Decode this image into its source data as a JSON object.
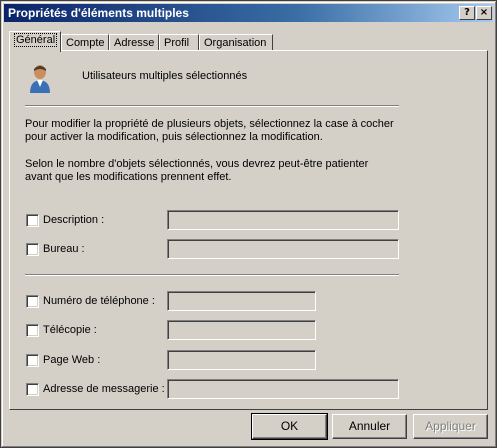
{
  "window": {
    "title": "Propriétés d'éléments multiples"
  },
  "titlebar_buttons": {
    "help": "?",
    "close": "×"
  },
  "tabs": [
    {
      "label": "Général",
      "active": true
    },
    {
      "label": "Compte",
      "active": false
    },
    {
      "label": "Adresse",
      "active": false
    },
    {
      "label": "Profil",
      "active": false
    },
    {
      "label": "Organisation",
      "active": false
    }
  ],
  "header": {
    "text": "Utilisateurs multiples sélectionnés",
    "icon": "users-icon"
  },
  "info": {
    "line1": "Pour modifier la propriété de plusieurs objets, sélectionnez la case à cocher",
    "line2": "pour activer la modification, puis sélectionnez la modification.",
    "line3": "Selon le nombre d'objets sélectionnés, vous devrez peut-être patienter",
    "line4": "avant que les modifications prennent effet."
  },
  "fields": {
    "description": {
      "label": "Description :",
      "value": "",
      "checked": false
    },
    "bureau": {
      "label": "Bureau :",
      "value": "",
      "checked": false
    },
    "telephone": {
      "label": "Numéro de téléphone :",
      "value": "",
      "checked": false
    },
    "telecopie": {
      "label": "Télécopie :",
      "value": "",
      "checked": false
    },
    "pageweb": {
      "label": "Page Web :",
      "value": "",
      "checked": false
    },
    "messagerie": {
      "label": "Adresse de messagerie :",
      "value": "",
      "checked": false
    }
  },
  "buttons": {
    "ok": "OK",
    "cancel": "Annuler",
    "apply": "Appliquer"
  }
}
